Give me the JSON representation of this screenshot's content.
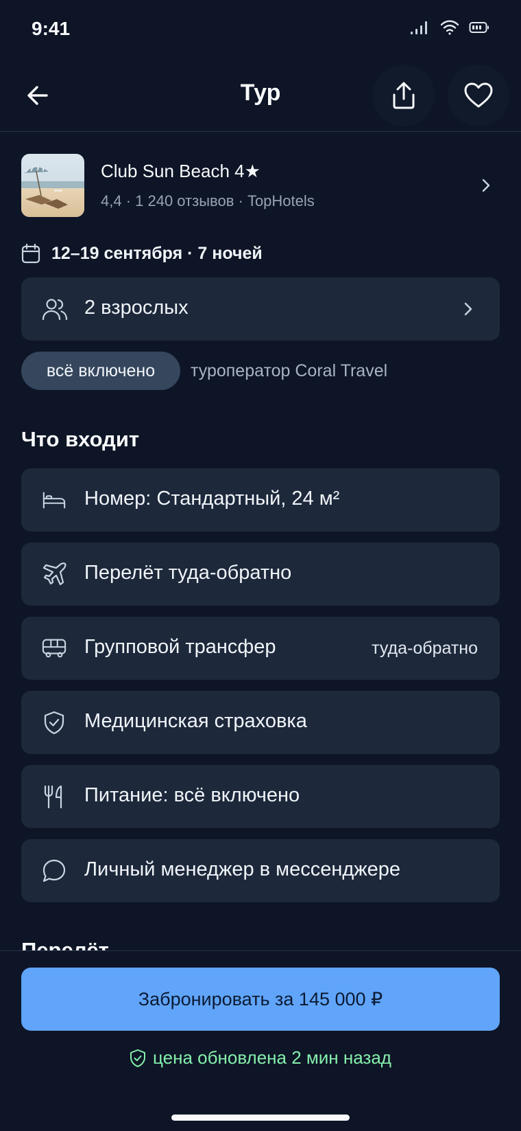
{
  "status_bar": {
    "time": "9:41"
  },
  "header": {
    "title": "Тур"
  },
  "hotel": {
    "name": "Club Sun Beach 4★",
    "meta": "4,4 · 1 240 отзывов · TopHotels"
  },
  "dates": {
    "text": "12–19 сентября · 7 ночей"
  },
  "guests": {
    "text": "2 взрослых"
  },
  "board_chip": "всё включено",
  "operator": "туроператор Coral Travel",
  "included": {
    "title": "Что входит",
    "items": [
      {
        "icon": "bed-icon",
        "label": "Номер: Стандартный, 24 м²",
        "extra": ""
      },
      {
        "icon": "plane-icon",
        "label": "Перелёт туда-обратно",
        "extra": ""
      },
      {
        "icon": "bus-icon",
        "label": "Групповой трансфер",
        "extra": "туда-обратно"
      },
      {
        "icon": "shield-check-icon",
        "label": "Медицинская страховка",
        "extra": ""
      },
      {
        "icon": "utensils-icon",
        "label": "Питание: всё включено",
        "extra": ""
      },
      {
        "icon": "chat-bubble-icon",
        "label": "Личный менеджер в мессенджере",
        "extra": ""
      }
    ]
  },
  "next_section_title": "Перелёт",
  "footer": {
    "book_label": "Забронировать за 145 000 ₽",
    "price_note": "цена обновлена 2 мин назад"
  },
  "colors": {
    "background": "#0d1526",
    "card": "#1d283b",
    "accent": "#60a5fa",
    "success": "#86efac"
  }
}
